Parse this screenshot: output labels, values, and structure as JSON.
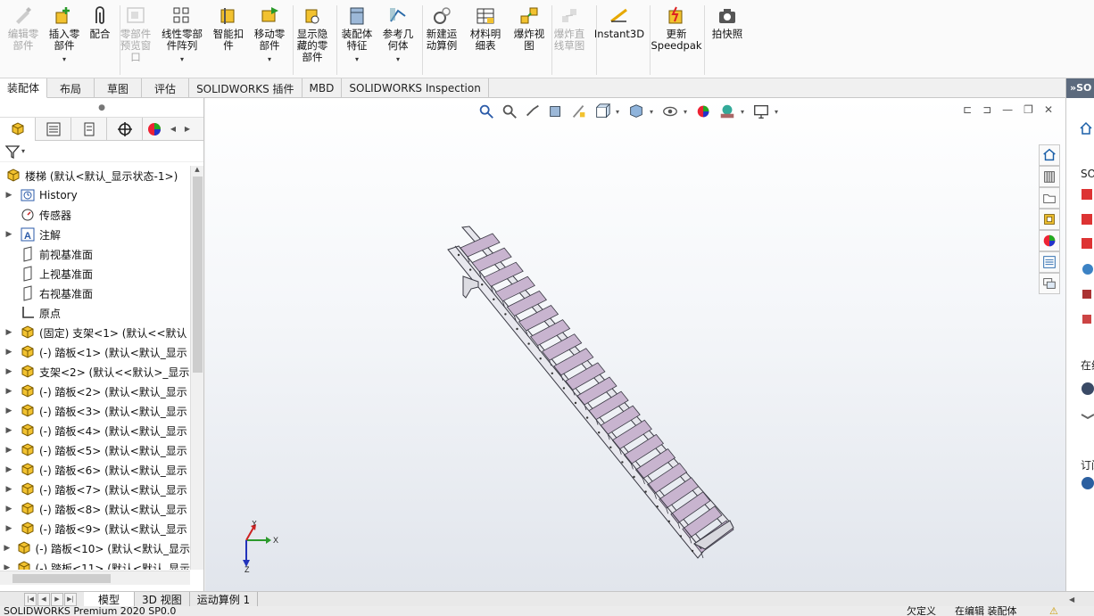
{
  "ribbon": {
    "buttons": [
      {
        "label": "编辑零\n部件",
        "icon": "edit-component-icon",
        "enabled": false
      },
      {
        "label": "插入零\n部件",
        "icon": "insert-components-icon",
        "enabled": true
      },
      {
        "label": "配合",
        "icon": "mate-paperclip-icon",
        "enabled": true
      },
      {
        "label": "零部件\n预览窗\n口",
        "icon": "component-preview-icon",
        "enabled": false
      },
      {
        "label": "线性零部\n件阵列",
        "icon": "linear-pattern-icon",
        "enabled": true
      },
      {
        "label": "智能扣\n件",
        "icon": "smart-fasteners-icon",
        "enabled": true
      },
      {
        "label": "移动零\n部件",
        "icon": "move-component-icon",
        "enabled": true
      },
      {
        "label": "显示隐\n藏的零\n部件",
        "icon": "show-hidden-icon",
        "enabled": true
      },
      {
        "label": "装配体\n特征",
        "icon": "assembly-features-icon",
        "enabled": true
      },
      {
        "label": "参考几\n何体",
        "icon": "reference-geometry-icon",
        "enabled": true
      },
      {
        "label": "新建运\n动算例",
        "icon": "new-motion-study-icon",
        "enabled": true
      },
      {
        "label": "材料明\n细表",
        "icon": "bom-icon",
        "enabled": true
      },
      {
        "label": "爆炸视\n图",
        "icon": "exploded-view-icon",
        "enabled": true
      },
      {
        "label": "爆炸直\n线草图",
        "icon": "explode-line-sketch-icon",
        "enabled": false
      },
      {
        "label": "Instant3D",
        "icon": "instant3d-icon",
        "enabled": true
      },
      {
        "label": "更新\nSpeedpak",
        "icon": "speedpak-icon",
        "enabled": true
      },
      {
        "label": "拍快照",
        "icon": "camera-icon",
        "enabled": true
      }
    ]
  },
  "tabs": [
    "装配体",
    "布局",
    "草图",
    "评估",
    "SOLIDWORKS 插件",
    "MBD",
    "SOLIDWORKS Inspection"
  ],
  "tree": {
    "root": "楼梯  (默认<默认_显示状态-1>)",
    "items": [
      {
        "label": "History",
        "icon": "history-icon",
        "expand": true
      },
      {
        "label": "传感器",
        "icon": "sensor-icon",
        "expand": false
      },
      {
        "label": "注解",
        "icon": "annotation-icon",
        "expand": true
      },
      {
        "label": "前视基准面",
        "icon": "plane-icon",
        "expand": false
      },
      {
        "label": "上视基准面",
        "icon": "plane-icon",
        "expand": false
      },
      {
        "label": "右视基准面",
        "icon": "plane-icon",
        "expand": false
      },
      {
        "label": "原点",
        "icon": "origin-icon",
        "expand": false
      },
      {
        "label": "(固定) 支架<1> (默认<<默认",
        "icon": "part-icon",
        "expand": true
      },
      {
        "label": "(-) 踏板<1> (默认<默认_显示",
        "icon": "part-icon",
        "expand": true
      },
      {
        "label": "支架<2> (默认<<默认>_显示",
        "icon": "part-icon",
        "expand": true
      },
      {
        "label": "(-) 踏板<2> (默认<默认_显示",
        "icon": "part-icon",
        "expand": true
      },
      {
        "label": "(-) 踏板<3> (默认<默认_显示",
        "icon": "part-icon",
        "expand": true
      },
      {
        "label": "(-) 踏板<4> (默认<默认_显示",
        "icon": "part-icon",
        "expand": true
      },
      {
        "label": "(-) 踏板<5> (默认<默认_显示",
        "icon": "part-icon",
        "expand": true
      },
      {
        "label": "(-) 踏板<6> (默认<默认_显示",
        "icon": "part-icon",
        "expand": true
      },
      {
        "label": "(-) 踏板<7> (默认<默认_显示",
        "icon": "part-icon",
        "expand": true
      },
      {
        "label": "(-) 踏板<8> (默认<默认_显示",
        "icon": "part-icon",
        "expand": true
      },
      {
        "label": "(-) 踏板<9> (默认<默认_显示",
        "icon": "part-icon",
        "expand": true
      },
      {
        "label": "(-) 踏板<10> (默认<默认_显示",
        "icon": "part-icon",
        "expand": true
      },
      {
        "label": "(-) 踏板<11> (默认<默认_显示",
        "icon": "part-icon",
        "expand": true
      }
    ]
  },
  "taskpane": {
    "header": "SO",
    "section_labels": [
      "SO",
      "在线",
      "订阅"
    ]
  },
  "triad": {
    "x": "X",
    "y": "Y",
    "z": "Z"
  },
  "bottom_tabs": [
    "模型",
    "3D 视图",
    "运动算例 1"
  ],
  "status": {
    "left": "SOLIDWORKS Premium 2020 SP0.0",
    "mid": "欠定义",
    "right": "在编辑 装配体"
  },
  "colors": {
    "accent": "#1a5fa8",
    "step_fill": "#c8b4cf",
    "stringer": "#e8e8ee",
    "outline": "#3a3a44"
  }
}
